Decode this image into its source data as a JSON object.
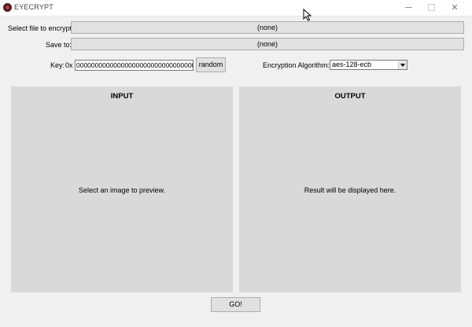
{
  "window": {
    "title": "EYECRYPT",
    "minimize_icon": "minimize-icon",
    "maximize_icon": "maximize-icon",
    "close_icon": "close-icon",
    "close_glyph": "✕"
  },
  "file_select": {
    "label": "Select file to encrypt:",
    "value": "(none)"
  },
  "save_to": {
    "label": "Save to:",
    "value": "(none)"
  },
  "key": {
    "label": "Key:",
    "prefix": "0x",
    "value": "00000000000000000000000000000000",
    "random_label": "random"
  },
  "algorithm": {
    "label": "Encryption Algorithm:",
    "selected": "aes-128-ecb"
  },
  "input_panel": {
    "title": "INPUT",
    "message": "Select an image to preview."
  },
  "output_panel": {
    "title": "OUTPUT",
    "message": "Result will be displayed here."
  },
  "actions": {
    "go_label": "GO!"
  }
}
